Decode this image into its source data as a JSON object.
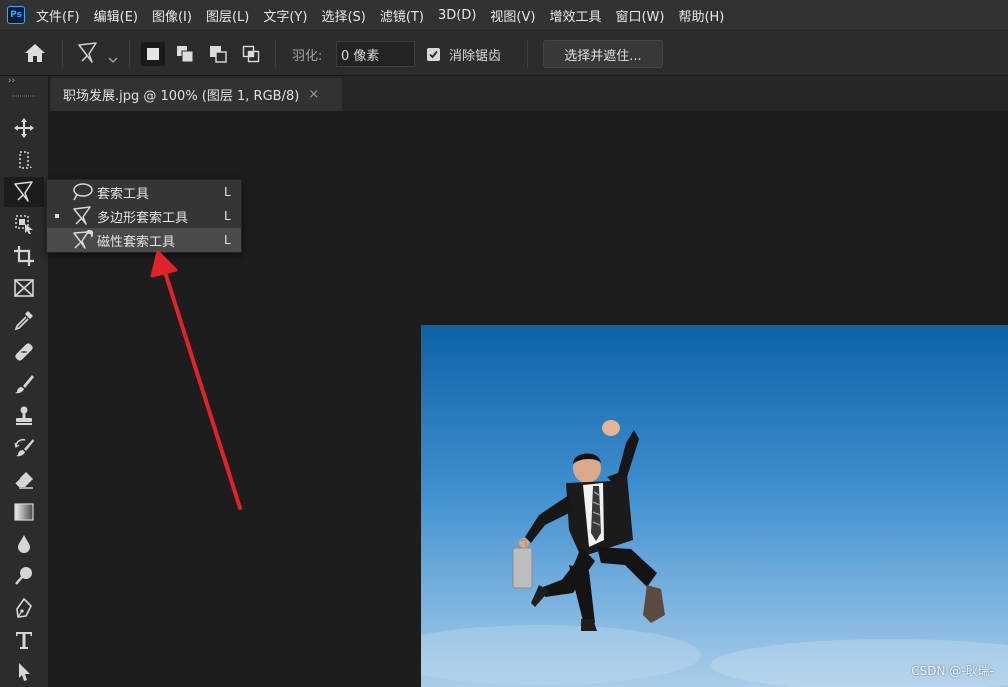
{
  "app": {
    "logo": "Ps"
  },
  "menu": [
    "文件(F)",
    "编辑(E)",
    "图像(I)",
    "图层(L)",
    "文字(Y)",
    "选择(S)",
    "滤镜(T)",
    "3D(D)",
    "视图(V)",
    "增效工具",
    "窗口(W)",
    "帮助(H)"
  ],
  "options": {
    "feather_label": "羽化:",
    "feather_value": "0 像素",
    "antialias_label": "消除锯齿",
    "antialias_checked": true,
    "select_and_mask": "选择并遮住..."
  },
  "document": {
    "tab_title": "职场发展.jpg @ 100% (图层 1, RGB/8)",
    "close_glyph": "×"
  },
  "toolbar": {
    "collapse_glyph": "››",
    "tools": [
      "move-icon",
      "marquee-icon",
      "polygonal-lasso-icon",
      "object-select-icon",
      "crop-icon",
      "frame-icon",
      "eyedropper-icon",
      "healing-icon",
      "brush-icon",
      "stamp-icon",
      "history-brush-icon",
      "eraser-icon",
      "gradient-icon",
      "blur-icon",
      "dodge-icon",
      "pen-icon",
      "type-icon",
      "path-select-icon"
    ]
  },
  "flyout": {
    "items": [
      {
        "label": "套索工具",
        "shortcut": "L",
        "icon": "lasso-icon",
        "selected": false
      },
      {
        "label": "多边形套索工具",
        "shortcut": "L",
        "icon": "polygonal-lasso-icon",
        "selected": true
      },
      {
        "label": "磁性套索工具",
        "shortcut": "L",
        "icon": "magnetic-lasso-icon",
        "selected": false
      }
    ],
    "hovered_index": 2
  },
  "annotation": {
    "arrow_color": "#e0222b"
  },
  "watermark": "CSDN @-耿瑞-",
  "colors": {
    "menubar": "#323232",
    "panel": "#2c2c2c",
    "canvas": "#1d1d1d",
    "sky_top": "#0d62a6",
    "sky_bottom": "#a9cdea"
  }
}
